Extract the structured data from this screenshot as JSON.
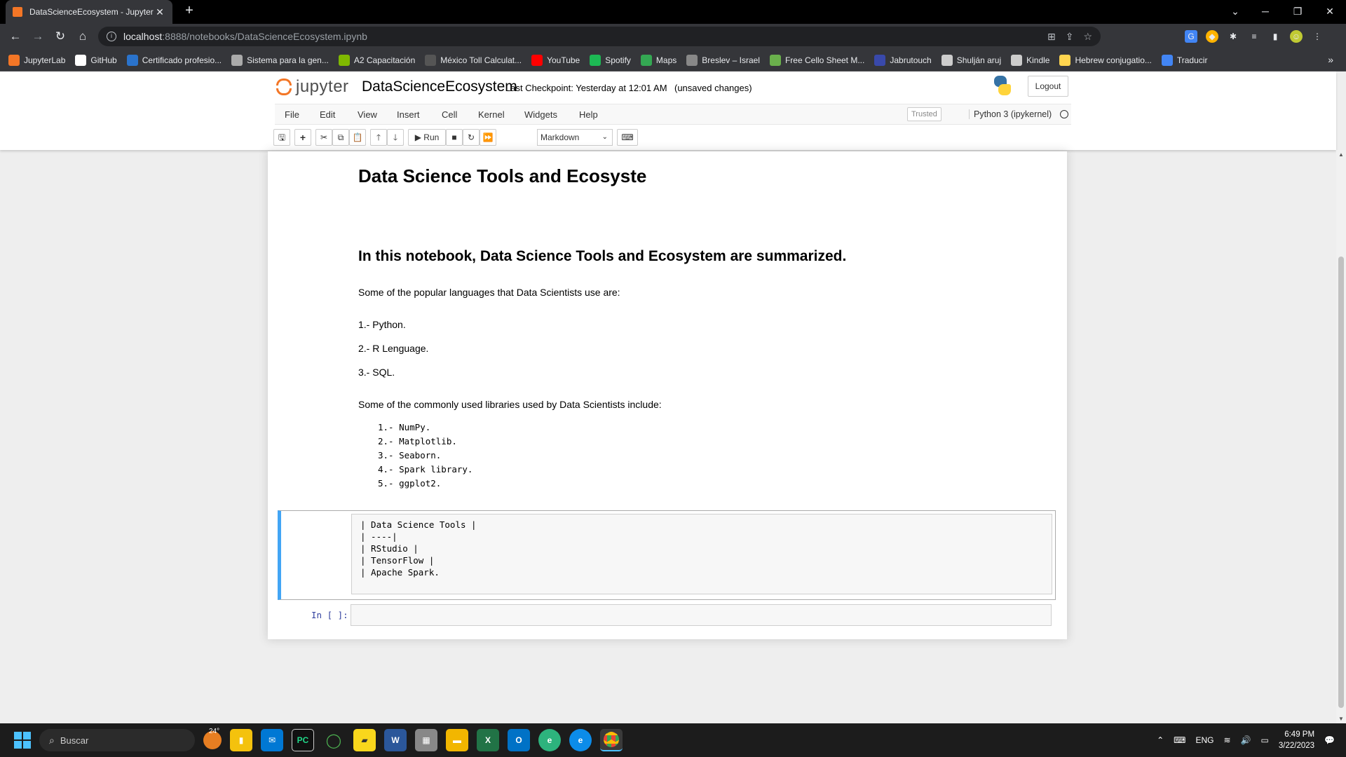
{
  "browser": {
    "tab_title": "DataScienceEcosystem - Jupyter",
    "url_host": "localhost",
    "url_path": ":8888/notebooks/DataScienceEcosystem.ipynb",
    "bookmarks": [
      {
        "label": "JupyterLab",
        "icon": "jupyter-icon",
        "color": "#f37626"
      },
      {
        "label": "GitHub",
        "icon": "github-icon",
        "color": "#ffffff"
      },
      {
        "label": "Certificado profesio...",
        "icon": "coursera-icon",
        "color": "#2a73cc"
      },
      {
        "label": "Sistema para la gen...",
        "icon": "grid-icon",
        "color": "#aaaaaa"
      },
      {
        "label": "A2 Capacitación",
        "icon": "a2-icon",
        "color": "#7fb800"
      },
      {
        "label": "México Toll Calculat...",
        "icon": "toll-icon",
        "color": "#555555"
      },
      {
        "label": "YouTube",
        "icon": "youtube-icon",
        "color": "#ff0000"
      },
      {
        "label": "Spotify",
        "icon": "spotify-icon",
        "color": "#1db954"
      },
      {
        "label": "Maps",
        "icon": "maps-icon",
        "color": "#34a853"
      },
      {
        "label": "Breslev – Israel",
        "icon": "breslev-icon",
        "color": "#888888"
      },
      {
        "label": "Free Cello Sheet M...",
        "icon": "cello-icon",
        "color": "#6ab04c"
      },
      {
        "label": "Jabrutouch",
        "icon": "jabrutouch-icon",
        "color": "#3949ab"
      },
      {
        "label": "Shulján aruj",
        "icon": "globe-icon",
        "color": "#cccccc"
      },
      {
        "label": "Kindle",
        "icon": "globe-icon",
        "color": "#cccccc"
      },
      {
        "label": "Hebrew conjugatio...",
        "icon": "hebrew-icon",
        "color": "#ffd54f"
      },
      {
        "label": "Traducir",
        "icon": "translate-icon",
        "color": "#4285f4"
      }
    ],
    "more_bookmarks": "»"
  },
  "jupyter": {
    "logo_text": "jupyter",
    "notebook_name": "DataScienceEcosystem",
    "checkpoint": "Last Checkpoint: Yesterday at 12:01 AM",
    "unsaved": "(unsaved changes)",
    "logout": "Logout",
    "menu": [
      "File",
      "Edit",
      "View",
      "Insert",
      "Cell",
      "Kernel",
      "Widgets",
      "Help"
    ],
    "trusted": "Trusted",
    "kernel": "Python 3 (ipykernel)",
    "run_label": "Run",
    "cell_type": "Markdown"
  },
  "notebook": {
    "h1": "Data Science Tools and Ecosyste",
    "h2": "In this notebook, Data Science Tools and Ecosystem are summarized.",
    "languages_intro": "Some of the popular languages that Data Scientists use are:",
    "languages": [
      "1.- Python.",
      "2.- R Lenguage.",
      "3.- SQL."
    ],
    "libraries_intro": "Some of the commonly used libraries used by Data Scientists include:",
    "libraries": [
      "1.- NumPy.",
      "2.- Matplotlib.",
      "3.- Seaborn.",
      "4.- Spark library.",
      "5.- ggplot2."
    ],
    "editor_source": "| Data Science Tools |\n| ----|\n| RStudio |\n| TensorFlow |\n| Apache Spark.",
    "code_prompt": "In [ ]:"
  },
  "taskbar": {
    "search_placeholder": "Buscar",
    "weather": "24°",
    "language": "ENG",
    "time": "6:49 PM",
    "date": "3/22/2023"
  }
}
